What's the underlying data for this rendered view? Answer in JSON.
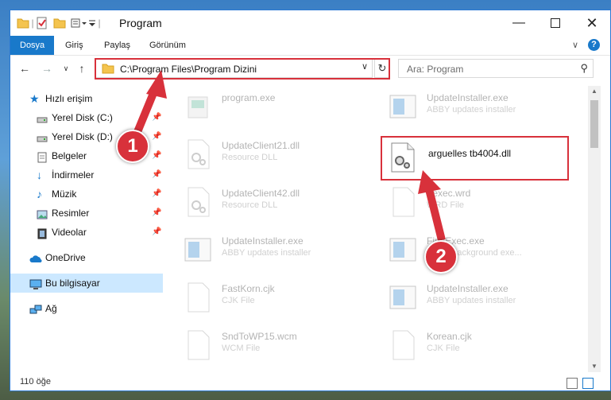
{
  "window": {
    "title": "Program",
    "controls": [
      "minimize-icon",
      "maximize-icon",
      "close-icon"
    ]
  },
  "ribbon": {
    "tabs": [
      "Dosya",
      "Giriş",
      "Paylaş",
      "Görünüm"
    ],
    "active_tab": "Dosya",
    "accent": "#1979ca"
  },
  "address": {
    "path": "C:\\Program Files\\Program Dizini"
  },
  "search": {
    "placeholder": "Ara: Program"
  },
  "sidebar": {
    "quick_access": "Hızlı erişim",
    "items": [
      {
        "label": "Yerel Disk (C:)",
        "icon": "drive-icon",
        "pinned": true
      },
      {
        "label": "Yerel Disk (D:)",
        "icon": "drive-icon",
        "pinned": true
      },
      {
        "label": "Belgeler",
        "icon": "documents-icon",
        "pinned": true
      },
      {
        "label": "İndirmeler",
        "icon": "download-icon",
        "pinned": true
      },
      {
        "label": "Müzik",
        "icon": "music-icon",
        "pinned": true
      },
      {
        "label": "Resimler",
        "icon": "pictures-icon",
        "pinned": true
      },
      {
        "label": "Videolar",
        "icon": "videos-icon",
        "pinned": true
      }
    ],
    "onedrive": "OneDrive",
    "this_pc": "Bu bilgisayar",
    "network": "Ağ"
  },
  "files": {
    "left": [
      {
        "name": "program.exe",
        "type": ""
      },
      {
        "name": "UpdateClient21.dll",
        "type": "Resource DLL"
      },
      {
        "name": "UpdateClient42.dll",
        "type": "Resource DLL"
      },
      {
        "name": "UpdateInstaller.exe",
        "type": "ABBY updates installer"
      },
      {
        "name": "FastKorn.cjk",
        "type": "CJK File"
      },
      {
        "name": "SndToWP15.wcm",
        "type": "WCM File"
      }
    ],
    "right": [
      {
        "name": "UpdateInstaller.exe",
        "type": "ABBY updates installer"
      },
      {
        "name": "arguelles tb4004.dll",
        "type": ""
      },
      {
        "name": "Fexec.wrd",
        "type": "WRD File"
      },
      {
        "name": "FineExec.exe",
        "type": "ABBY background exe..."
      },
      {
        "name": "UpdateInstaller.exe",
        "type": "ABBY updates installer"
      },
      {
        "name": "Korean.cjk",
        "type": "CJK File"
      }
    ]
  },
  "status": {
    "count": "110 öğe"
  },
  "callouts": [
    "1",
    "2"
  ],
  "highlight_color": "#d8313b"
}
